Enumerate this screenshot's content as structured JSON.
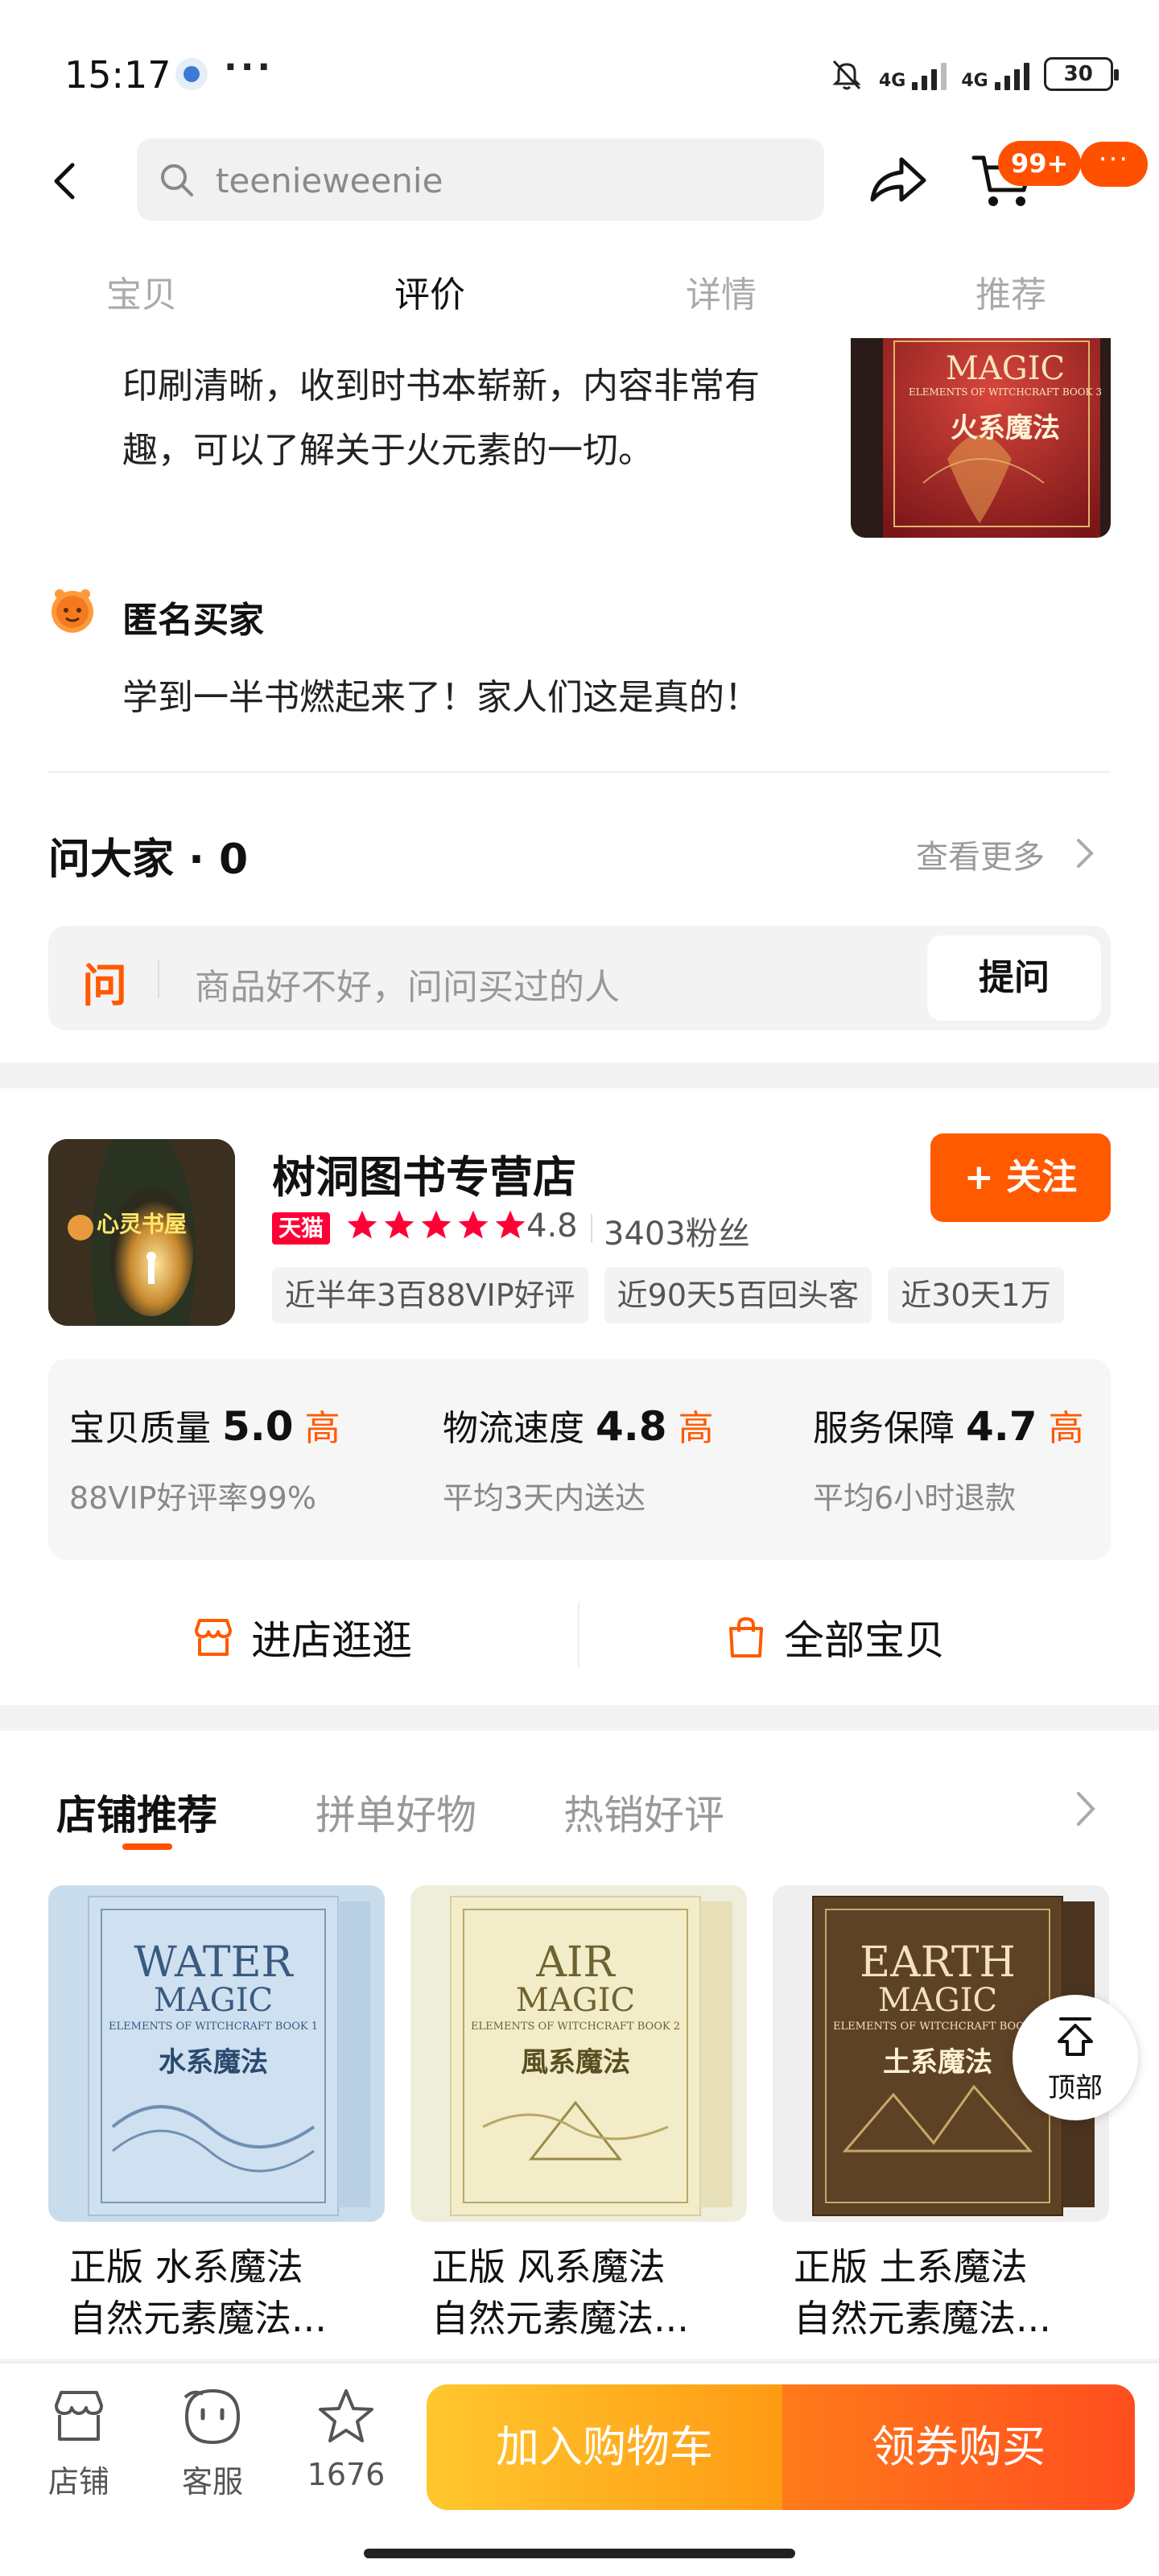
{
  "status_bar": {
    "time": "15:17",
    "more": "···",
    "network_1": "4G",
    "network_2": "4G",
    "battery": "30"
  },
  "header": {
    "search_text": "teenieweenie",
    "cart_badge": "99+",
    "more_label": "···"
  },
  "tabs": [
    {
      "label": "宝贝"
    },
    {
      "label": "评价"
    },
    {
      "label": "详情"
    },
    {
      "label": "推荐"
    }
  ],
  "reviews": {
    "review1_text": "印刷清晰，收到时书本崭新，内容非常有趣，可以了解关于火元素的一切。",
    "review1_image_title": "MAGIC",
    "review1_image_sub": "火系魔法",
    "review1_image_series": "ELEMENTS OF WITCHCRAFT BOOK 3",
    "review2_name": "匿名买家",
    "review2_text": "学到一半书燃起来了！家人们这是真的！"
  },
  "qa": {
    "title": "问大家 · 0",
    "more": "查看更多",
    "icon_char": "问",
    "placeholder": "商品好不好，问问买过的人",
    "ask_button": "提问"
  },
  "shop": {
    "name": "树洞图书专营店",
    "logo_text": "心灵书屋",
    "tmall_badge": "天猫",
    "rating": "4.8",
    "stars": 5,
    "fans": "3403粉丝",
    "follow_button": "+ 关注",
    "chips": [
      "近半年3百88VIP好评",
      "近90天5百回头客",
      "近30天1万"
    ],
    "scores": [
      {
        "label": "宝贝质量",
        "value": "5.0",
        "level": "高",
        "sub": "88VIP好评率99%"
      },
      {
        "label": "物流速度",
        "value": "4.8",
        "level": "高",
        "sub": "平均3天内送达"
      },
      {
        "label": "服务保障",
        "value": "4.7",
        "level": "高",
        "sub": "平均6小时退款"
      }
    ],
    "enter_shop": "进店逛逛",
    "all_items": "全部宝贝"
  },
  "recommend": {
    "tabs": [
      "店铺推荐",
      "拼单好物",
      "热销好评"
    ],
    "products": [
      {
        "title": "正版 水系魔法",
        "subtitle": "自然元素魔法...",
        "cover_title": "WATER",
        "cover_sub": "MAGIC",
        "cover_cn": "水系魔法",
        "cover_series": "ELEMENTS OF WITCHCRAFT BOOK 1"
      },
      {
        "title": "正版 风系魔法",
        "subtitle": "自然元素魔法...",
        "cover_title": "AIR",
        "cover_sub": "MAGIC",
        "cover_cn": "風系魔法",
        "cover_series": "ELEMENTS OF WITCHCRAFT BOOK 2"
      },
      {
        "title": "正版 土系魔法",
        "subtitle": "自然元素魔法...",
        "cover_title": "EARTH",
        "cover_sub": "MAGIC",
        "cover_cn": "土系魔法",
        "cover_series": "ELEMENTS OF WITCHCRAFT BOOK 4"
      }
    ],
    "to_top": "顶部"
  },
  "bottom_bar": {
    "shop": "店铺",
    "service": "客服",
    "fav_count": "1676",
    "add_cart": "加入购物车",
    "buy": "领券购买"
  },
  "colors": {
    "accent": "#ff5000",
    "tmall": "#ff0036",
    "cta_yellow": "#ffc72e",
    "cta_orange": "#ff4e1f"
  },
  "icons": [
    "back-arrow-icon",
    "search-icon",
    "share-icon",
    "cart-icon",
    "more-icon",
    "chevron-right-icon",
    "store-icon",
    "bag-icon",
    "customer-service-icon",
    "star-icon",
    "to-top-icon"
  ]
}
